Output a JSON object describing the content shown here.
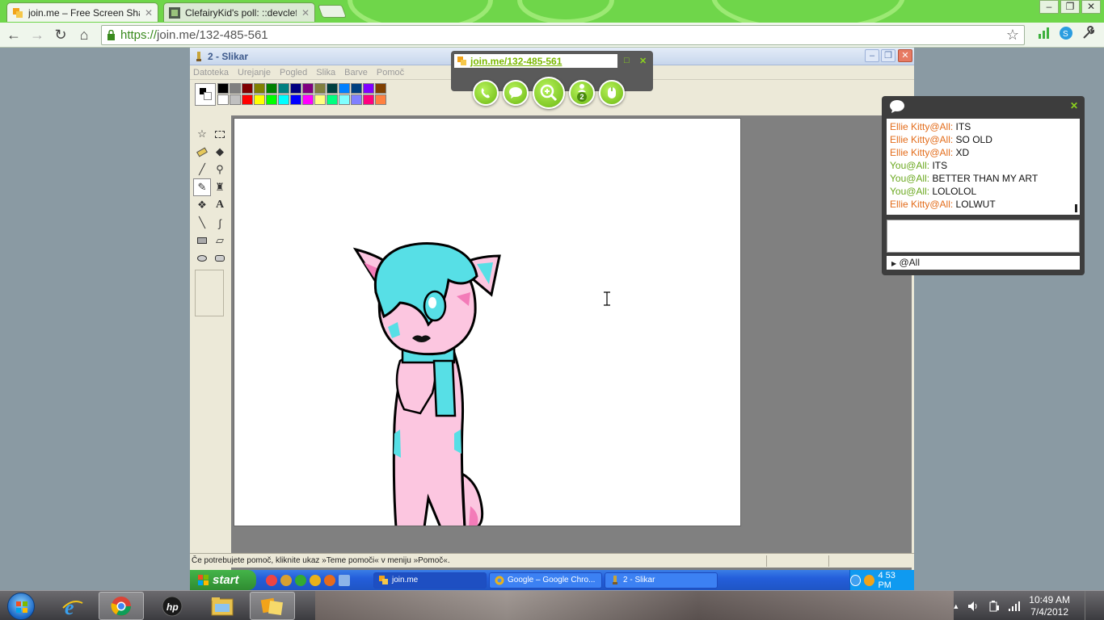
{
  "browser": {
    "tabs": [
      {
        "title": "join.me – Free Screen Shari",
        "active": true
      },
      {
        "title": "ClefairyKid's poll: ::devclefa",
        "active": false
      }
    ],
    "address": {
      "scheme": "https://",
      "rest": "join.me/132-485-561"
    }
  },
  "paint": {
    "title": "2 - Slikar",
    "menu": [
      "Datoteka",
      "Urejanje",
      "Pogled",
      "Slika",
      "Barve",
      "Pomoč"
    ],
    "palette_top": [
      "#000000",
      "#808080",
      "#800000",
      "#808000",
      "#008000",
      "#008080",
      "#000080",
      "#800080",
      "#808040",
      "#004040",
      "#0080ff",
      "#004080",
      "#8000ff",
      "#804000"
    ],
    "palette_bottom": [
      "#ffffff",
      "#c0c0c0",
      "#ff0000",
      "#ffff00",
      "#00ff00",
      "#00ffff",
      "#0000ff",
      "#ff00ff",
      "#ffff80",
      "#00ff80",
      "#80ffff",
      "#8080ff",
      "#ff0080",
      "#ff8040"
    ],
    "status_text": "Če potrebujete pomoč, kliknite ukaz »Teme pomoči« v meniju »Pomoč«."
  },
  "remote_taskbar": {
    "start": "start",
    "tasks": [
      {
        "label": "join.me",
        "active": true
      },
      {
        "label": "Google – Google Chro...",
        "active": false
      },
      {
        "label": "2 - Slikar",
        "active": false
      }
    ],
    "clock": "4 53 PM"
  },
  "joinme": {
    "url": "join.me/132-485-561",
    "participants": "2"
  },
  "chat": {
    "messages": [
      {
        "who": "Ellie Kitty@All:",
        "text": "ITS",
        "color": "#e36c1a"
      },
      {
        "who": "Ellie Kitty@All:",
        "text": "SO OLD",
        "color": "#e36c1a"
      },
      {
        "who": "Ellie Kitty@All:",
        "text": "XD",
        "color": "#e36c1a"
      },
      {
        "who": "You@All:",
        "text": "ITS",
        "color": "#6aa81e"
      },
      {
        "who": "You@All:",
        "text": "BETTER THAN MY ART",
        "color": "#6aa81e"
      },
      {
        "who": "You@All:",
        "text": "LOLOLOL",
        "color": "#6aa81e"
      },
      {
        "who": "Ellie Kitty@All:",
        "text": "LOLWUT",
        "color": "#e36c1a"
      }
    ],
    "recipient": "@All"
  },
  "taskbar": {
    "time": "10:49 AM",
    "date": "7/4/2012"
  }
}
